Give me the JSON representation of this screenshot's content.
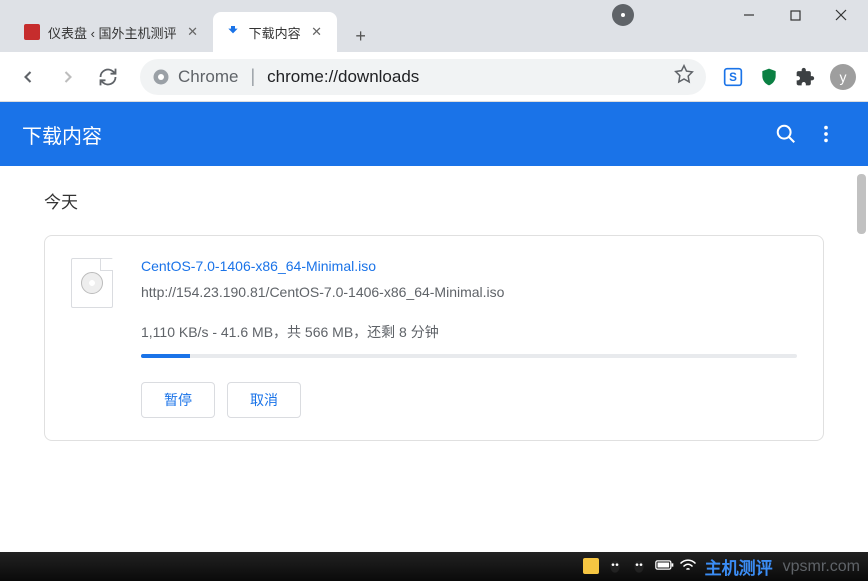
{
  "tabs": [
    {
      "title": "仪表盘 ‹ 国外主机测评",
      "favicon": "red",
      "active": false
    },
    {
      "title": "下载内容",
      "favicon": "download",
      "active": true
    }
  ],
  "toolbar": {
    "url_label": "Chrome",
    "url_path": "chrome://downloads",
    "avatar_letter": "y"
  },
  "page": {
    "title": "下载内容",
    "section_label": "今天"
  },
  "download": {
    "filename": "CentOS-7.0-1406-x86_64-Minimal.iso",
    "url": "http://154.23.190.81/CentOS-7.0-1406-x86_64-Minimal.iso",
    "status": "1,110 KB/s - 41.6 MB，共 566 MB，还剩 8 分钟",
    "progress_percent": 7.5,
    "pause_label": "暂停",
    "cancel_label": "取消"
  },
  "footer": {
    "brand1": "主机测评",
    "brand2": "vpsmr.com"
  }
}
